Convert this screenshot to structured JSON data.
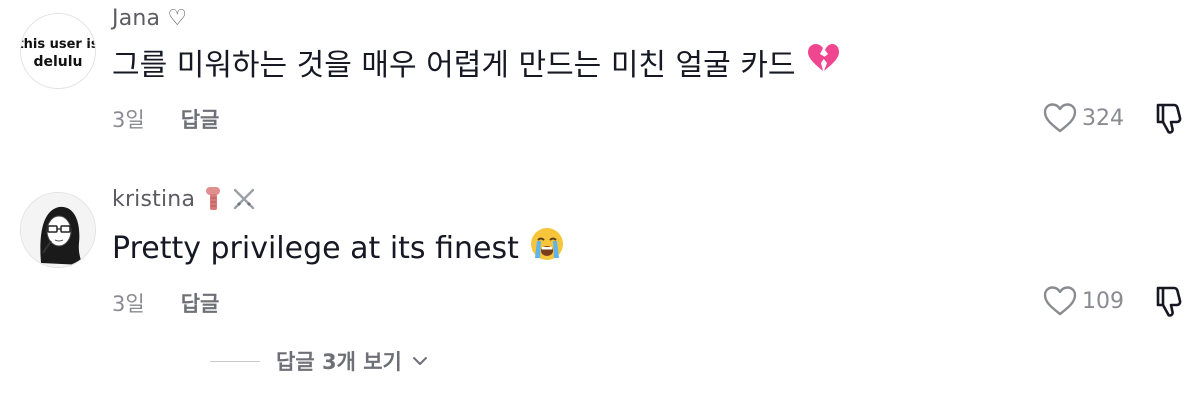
{
  "comments": [
    {
      "username": "Jana ♡",
      "text": "그를 미워하는 것을 매우 어렵게 만드는 미친 얼굴 카드",
      "emoji": "💔",
      "time": "3일",
      "reply_label": "답글",
      "likes": "324",
      "avatar_text": [
        "this user is",
        "delulu"
      ]
    },
    {
      "username": "kristina",
      "text": "Pretty privilege at its finest",
      "emoji": "😭",
      "time": "3일",
      "reply_label": "답글",
      "likes": "109"
    }
  ],
  "view_replies": {
    "label": "답글 3개 보기"
  },
  "icons": {
    "like": "heart-outline-icon",
    "dislike": "thumbs-down-icon",
    "expand": "chevron-down-icon",
    "flair": [
      "scarf-icon",
      "crossed-swords-icon"
    ]
  },
  "colors": {
    "text": "#161823",
    "secondary": "#8a8b91",
    "background": "#ffffff"
  }
}
